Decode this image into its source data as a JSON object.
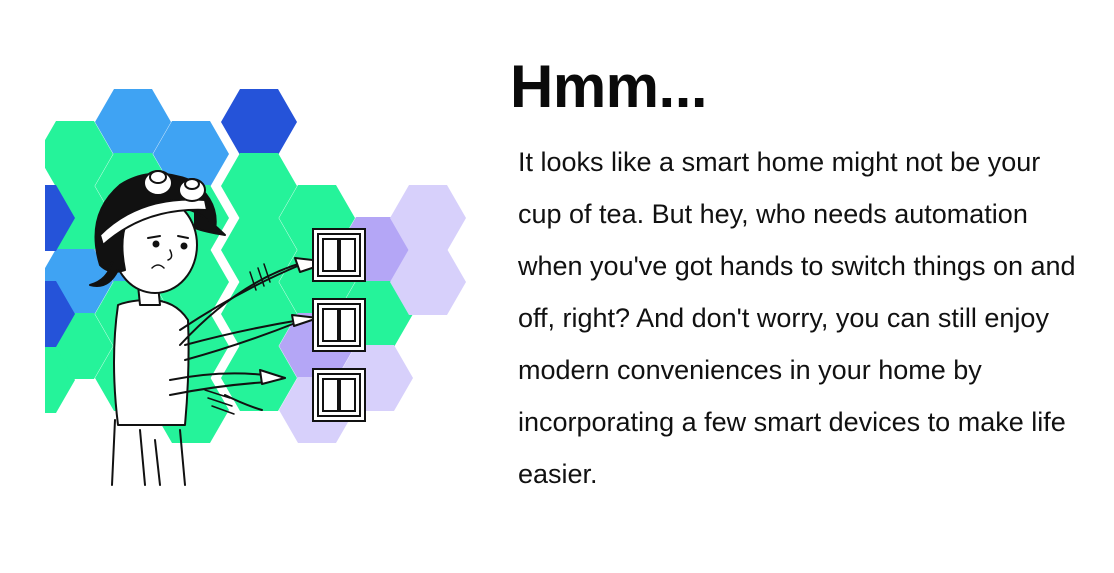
{
  "heading": "Hmm...",
  "message": "It looks like a smart home might not be your cup of tea. But hey, who needs automation when you've got hands to switch things on and off, right? And don't worry, you can still enjoy modern conveniences in your home by incorporating a few smart devices to make life easier.",
  "illustration": {
    "icon": "person-pressing-light-switches-illustration",
    "colors": {
      "green": "#25f39a",
      "light_blue": "#3fa3f3",
      "dark_blue": "#2553d9",
      "lavender": "#d7d0fb",
      "purple": "#b4a6f6"
    }
  }
}
